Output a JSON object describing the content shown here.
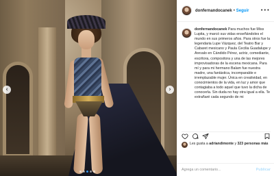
{
  "post": {
    "nav_prev_glyph": "‹",
    "nav_next_glyph": "›",
    "carousel_count": 5,
    "carousel_active": 3
  },
  "header": {
    "username": "donfernandocanek",
    "separator": "•",
    "follow_label": "Seguir",
    "more_glyph": "•••"
  },
  "caption": {
    "username": "donfernandocanek",
    "text": "Para muchos fue Miss Lupita, y marcó sus vidas enseñándoles el mundo en sus primeros años. Para otros fue la legendaria Lupe Vázquez, del Teatro Bar y Cabaret mexicano y Paula Cecilia Guadalupe y Arevalo en Cándido Pérez, actriz, comediante, escritora, compositora y una de las mejores improvisadoras de la escena mexicana. Para mí y para mi hermano Balam fue nuestra madre, una fantástica, incomparable e irremplazable mujer. Única en creatividad, en conocimientos de la vida, en luz y amor que contagiaba a todo aquel que tuvo la dicha de conocerla. Sin duda no hay otra igual a ella. Te extrañaré cada segundo de mi"
  },
  "likes": {
    "prefix": "Les gusta a ",
    "liker": "adriandimonte",
    "middle": " y ",
    "others": "323 personas más"
  },
  "timestamp": "",
  "comment": {
    "placeholder": "Agrega un comentario...",
    "post_label": "Publicar"
  },
  "colors": {
    "link": "#0095f6",
    "post_disabled": "#b2dffc",
    "carousel_active": "#3897f0"
  }
}
